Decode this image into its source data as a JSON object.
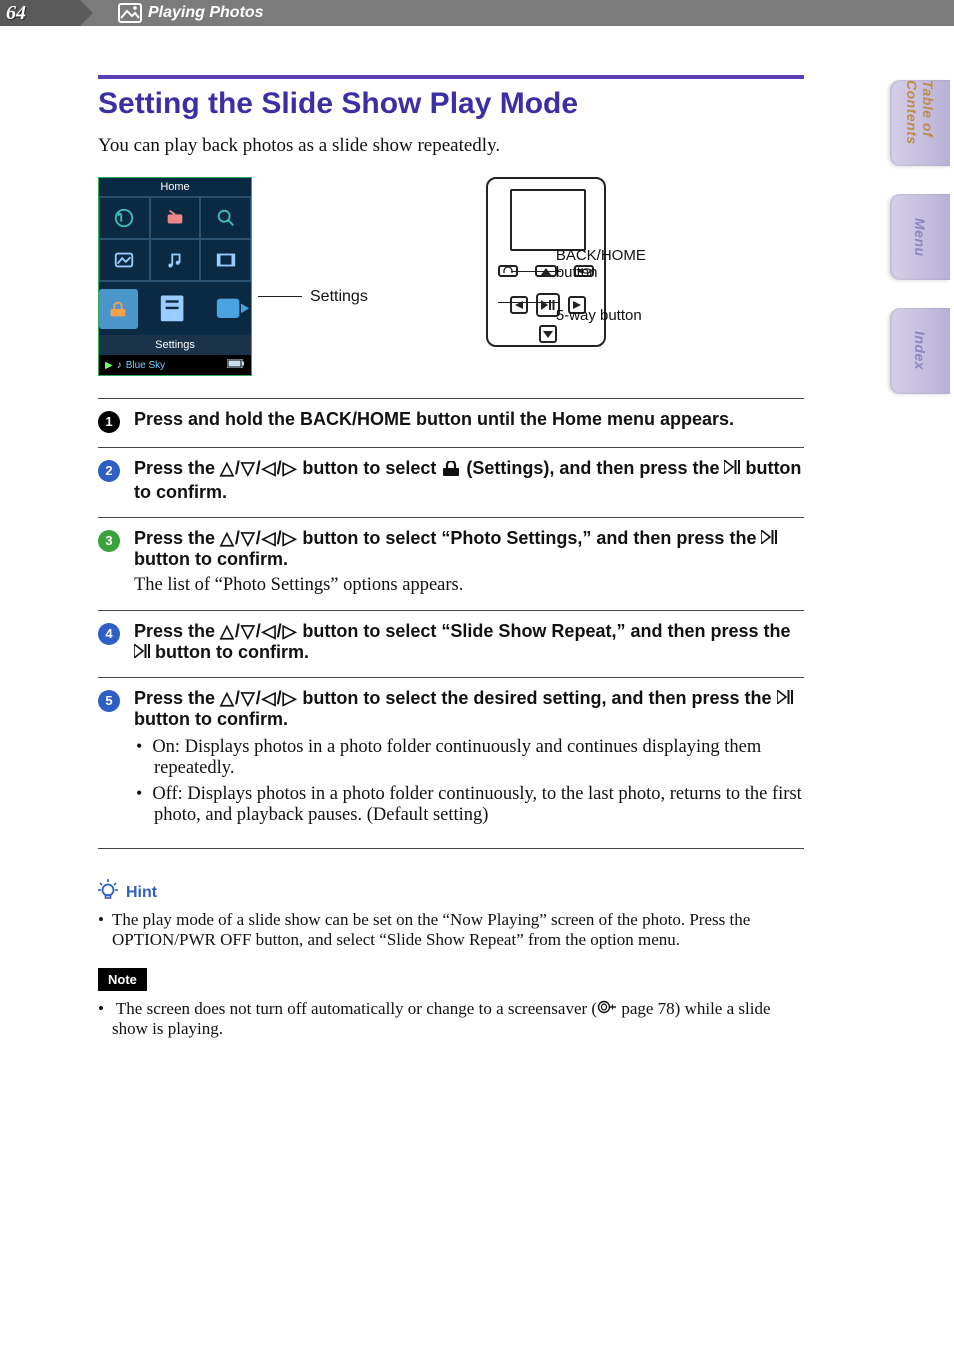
{
  "header": {
    "page_number": "64",
    "section": "Playing Photos"
  },
  "title": "Setting the Slide Show Play Mode",
  "intro": "You can play back photos as a slide show repeatedly.",
  "figure": {
    "screen_top_label": "Home",
    "screen_label": "Settings",
    "screen_now_playing": "Blue Sky",
    "leader_settings": "Settings",
    "callout_back_home": "BACK/HOME button",
    "callout_5way": "5-way button"
  },
  "steps": [
    {
      "num": "1",
      "color": "black",
      "bold": "Press and hold the BACK/HOME button until the Home menu appears."
    },
    {
      "num": "2",
      "color": "blue",
      "bold_pre": "Press the ",
      "bold_arrows": "△/▽/◁/▷",
      "bold_mid": " button to select ",
      "icon": "settings-icon",
      "bold_post": " (Settings), and then press the ",
      "play_confirm": true,
      "bold_tail": " button to confirm."
    },
    {
      "num": "3",
      "color": "green",
      "bold_pre": "Press the ",
      "bold_arrows": "△/▽/◁/▷",
      "bold_mid": " button to select “Photo Settings,” and then press the ",
      "play_confirm": true,
      "bold_tail": " button to confirm.",
      "plain": "The list of “Photo Settings” options appears."
    },
    {
      "num": "4",
      "color": "blue",
      "bold_pre": "Press the ",
      "bold_arrows": "△/▽/◁/▷",
      "bold_mid": " button to select “Slide Show Repeat,” and then press the ",
      "play_confirm": true,
      "bold_tail": " button to confirm."
    },
    {
      "num": "5",
      "color": "blue",
      "bold_pre": "Press the ",
      "bold_arrows": "△/▽/◁/▷",
      "bold_mid": " button to select the desired setting, and then press the ",
      "play_confirm": true,
      "bold_tail": " button to confirm.",
      "options": [
        "On: Displays photos in a photo folder continuously and continues displaying them repeatedly.",
        "Off: Displays photos in a photo folder continuously, to the last photo, returns to the first photo, and playback pauses. (Default setting)"
      ]
    }
  ],
  "hint": {
    "label": "Hint",
    "text": "The play mode of a slide show can be set on the “Now Playing” screen of the photo. Press the OPTION/PWR OFF button, and select “Slide Show Repeat” from the option menu."
  },
  "note": {
    "label": "Note",
    "text_pre": "The screen does not turn off automatically or change to a screensaver (",
    "page_ref": " page 78",
    "text_post": ") while a slide show is playing."
  },
  "sidetabs": {
    "toc": "Table of Contents",
    "menu": "Menu",
    "index": "Index"
  }
}
